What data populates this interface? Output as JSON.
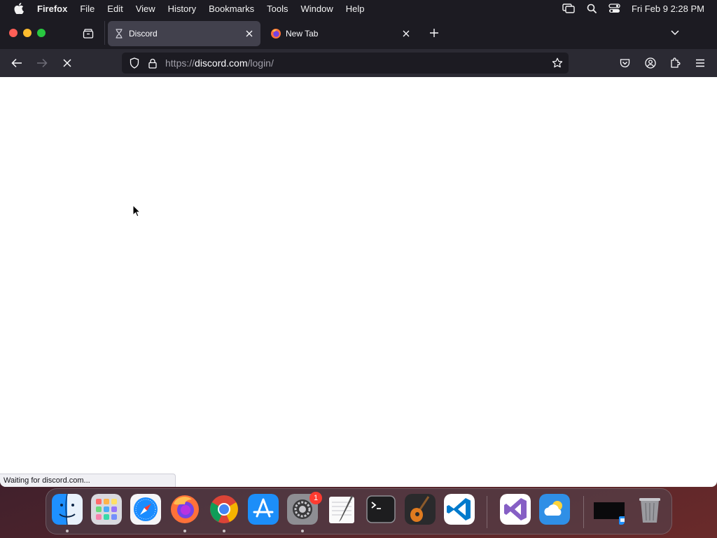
{
  "menubar": {
    "app_name": "Firefox",
    "items": [
      "File",
      "Edit",
      "View",
      "History",
      "Bookmarks",
      "Tools",
      "Window",
      "Help"
    ],
    "clock": "Fri Feb 9  2:28 PM"
  },
  "tabs": [
    {
      "label": "Discord",
      "favicon": "hourglass-icon",
      "active": true
    },
    {
      "label": "New Tab",
      "favicon": "firefox-icon",
      "active": false
    }
  ],
  "urlbar": {
    "scheme": "https://",
    "host": "discord.com",
    "path": "/login/"
  },
  "status": "Waiting for discord.com...",
  "dock": {
    "items": [
      "finder",
      "launchpad",
      "safari",
      "firefox",
      "chrome",
      "app-store",
      "system-settings",
      "textedit",
      "terminal",
      "garageband",
      "vscode",
      "visual-studio",
      "weather",
      "screen-thumbnail",
      "trash"
    ],
    "system_settings_badge": "1"
  },
  "colors": {
    "chrome_dark": "#1c1b22",
    "toolbar": "#2b2a33",
    "active_tab": "#42414d",
    "close_red": "#ff5f57",
    "minimize_yellow": "#febc2e",
    "zoom_green": "#28c840"
  }
}
